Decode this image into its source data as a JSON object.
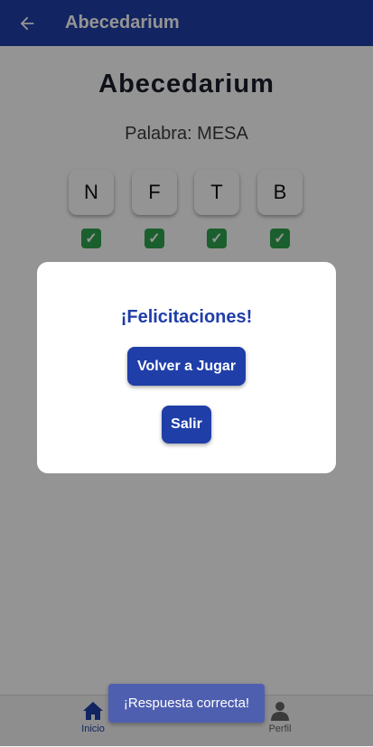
{
  "appbar": {
    "title": "Abecedarium",
    "back_icon": "arrow-left-icon"
  },
  "main": {
    "title": "Abecedarium",
    "word_label": "Palabra: MESA",
    "tiles": [
      {
        "letter": "N",
        "status": "correct"
      },
      {
        "letter": "F",
        "status": "correct"
      },
      {
        "letter": "T",
        "status": "correct"
      },
      {
        "letter": "B",
        "status": "correct"
      }
    ],
    "check_icon": "check-mark-icon"
  },
  "dialog": {
    "title": "¡Felicitaciones!",
    "play_again_label": "Volver a Jugar",
    "exit_label": "Salir"
  },
  "bottom_nav": {
    "items": [
      {
        "label": "Inicio",
        "icon": "home-icon",
        "active": true
      },
      {
        "label": "Perfil",
        "icon": "person-icon",
        "active": false
      }
    ]
  },
  "toast": {
    "message": "¡Respuesta correcta!"
  },
  "colors": {
    "primary": "#1f3ea8",
    "check": "#2ea44f",
    "toast": "#4f5fb0"
  }
}
